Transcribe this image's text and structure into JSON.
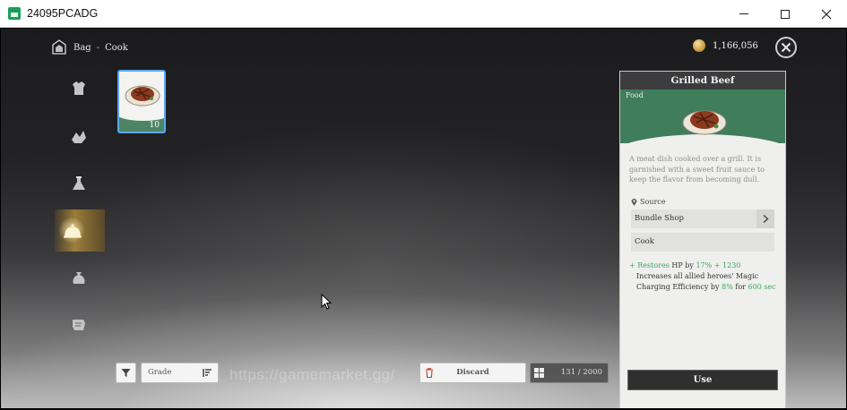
{
  "window": {
    "title": "24095PCADG",
    "icons": [
      "app-icon",
      "minimize-icon",
      "maximize-icon",
      "close-icon"
    ]
  },
  "header": {
    "breadcrumb_root": "Bag",
    "breadcrumb_separator": "-",
    "breadcrumb_current": "Cook",
    "currency_amount": "1,166,056",
    "icons": [
      "bag-icon",
      "coin-icon",
      "close-circle-icon"
    ]
  },
  "categories": [
    {
      "name": "armor",
      "icon": "armor-icon",
      "active": false
    },
    {
      "name": "materials",
      "icon": "materials-icon",
      "active": false
    },
    {
      "name": "potions",
      "icon": "flask-icon",
      "active": false
    },
    {
      "name": "cook",
      "icon": "cloche-icon",
      "active": true
    },
    {
      "name": "bags",
      "icon": "sack-icon",
      "active": false
    },
    {
      "name": "misc",
      "icon": "scroll-icon",
      "active": false
    }
  ],
  "inventory": {
    "items": [
      {
        "name": "Grilled Beef",
        "count": "10",
        "selected": true,
        "icon": "grilled-beef-icon"
      }
    ]
  },
  "detail": {
    "title": "Grilled Beef",
    "type": "Food",
    "description": "A meat dish cooked over a grill. It is garnished with a sweet fruit sauce to keep the flavor from becoming dull.",
    "source_label": "Source",
    "sources": [
      "Bundle Shop",
      "Cook"
    ],
    "effect": {
      "bullet": "+",
      "restores_label": "Restores",
      "hp_text": "HP by",
      "hp_value": "17% + 1230",
      "line2_a": "Increases all allied heroes' Magic",
      "line3_a": "Charging Efficiency by",
      "line3_value": "8%",
      "line3_for": "for",
      "line3_duration": "600 sec"
    },
    "use_label": "Use"
  },
  "footer": {
    "grade_label": "Grade",
    "discard_label": "Discard",
    "capacity": "131 / 2000",
    "icons": [
      "filter-icon",
      "sort-icon",
      "trash-icon",
      "grid-icon"
    ]
  },
  "watermark": "https://gamemarket.gg/",
  "colors": {
    "accent_green": "#3f7d5b",
    "effect_green": "#3ca660",
    "selection_blue": "#5aa7ff",
    "active_gold": "#be963c"
  }
}
